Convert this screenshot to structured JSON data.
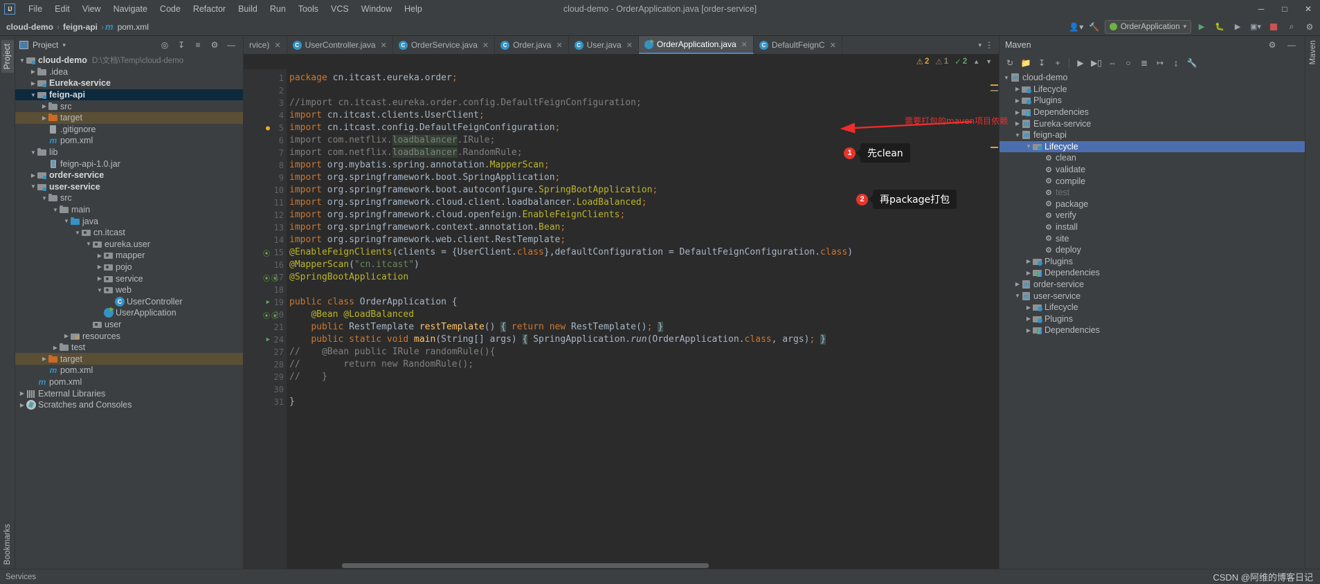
{
  "titlebar": {
    "logo": "IJ",
    "menus": [
      "File",
      "Edit",
      "View",
      "Navigate",
      "Code",
      "Refactor",
      "Build",
      "Run",
      "Tools",
      "VCS",
      "Window",
      "Help"
    ],
    "window_title": "cloud-demo - OrderApplication.java [order-service]",
    "minimize": "─",
    "maximize": "□",
    "close": "✕"
  },
  "navbar": {
    "crumb1": "cloud-demo",
    "crumb2": "feign-api",
    "crumb3": "pom.xml",
    "sep": "›",
    "m_icon": "m",
    "run_config": "OrderApplication",
    "search_icon": "⌕",
    "settings_icon": "⚙"
  },
  "project_panel": {
    "title": "Project",
    "vertical_label": "Project",
    "items": [
      {
        "depth": 0,
        "arrow": "v",
        "icon": "module",
        "label": "cloud-demo",
        "bold": true,
        "path": "D:\\文档\\Temp\\cloud-demo",
        "state": "none"
      },
      {
        "depth": 1,
        "arrow": ">",
        "icon": "folder",
        "label": ".idea",
        "bold": false,
        "path": "",
        "state": "none"
      },
      {
        "depth": 1,
        "arrow": ">",
        "icon": "module",
        "label": "Eureka-service",
        "bold": true,
        "path": "",
        "state": "none"
      },
      {
        "depth": 1,
        "arrow": "v",
        "icon": "module",
        "label": "feign-api",
        "bold": true,
        "path": "",
        "state": "blue"
      },
      {
        "depth": 2,
        "arrow": ">",
        "icon": "folder",
        "label": "src",
        "bold": false,
        "path": "",
        "state": "none"
      },
      {
        "depth": 2,
        "arrow": ">",
        "icon": "folder-orange",
        "label": "target",
        "bold": false,
        "path": "",
        "state": "tan"
      },
      {
        "depth": 2,
        "arrow": "",
        "icon": "git",
        "label": ".gitignore",
        "bold": false,
        "path": "",
        "state": "none"
      },
      {
        "depth": 2,
        "arrow": "",
        "icon": "mvn",
        "label": "pom.xml",
        "bold": false,
        "path": "",
        "state": "none"
      },
      {
        "depth": 1,
        "arrow": "v",
        "icon": "folder",
        "label": "lib",
        "bold": false,
        "path": "",
        "state": "none"
      },
      {
        "depth": 2,
        "arrow": "",
        "icon": "jar",
        "label": "feign-api-1.0.jar",
        "bold": false,
        "path": "",
        "state": "none"
      },
      {
        "depth": 1,
        "arrow": ">",
        "icon": "module",
        "label": "order-service",
        "bold": true,
        "path": "",
        "state": "none"
      },
      {
        "depth": 1,
        "arrow": "v",
        "icon": "module",
        "label": "user-service",
        "bold": true,
        "path": "",
        "state": "none"
      },
      {
        "depth": 2,
        "arrow": "v",
        "icon": "folder",
        "label": "src",
        "bold": false,
        "path": "",
        "state": "none"
      },
      {
        "depth": 3,
        "arrow": "v",
        "icon": "folder",
        "label": "main",
        "bold": false,
        "path": "",
        "state": "none"
      },
      {
        "depth": 4,
        "arrow": "v",
        "icon": "folder-blue",
        "label": "java",
        "bold": false,
        "path": "",
        "state": "none"
      },
      {
        "depth": 5,
        "arrow": "v",
        "icon": "pkg",
        "label": "cn.itcast",
        "bold": false,
        "path": "",
        "state": "none"
      },
      {
        "depth": 6,
        "arrow": "v",
        "icon": "pkg",
        "label": "eureka.user",
        "bold": false,
        "path": "",
        "state": "none"
      },
      {
        "depth": 7,
        "arrow": ">",
        "icon": "pkg",
        "label": "mapper",
        "bold": false,
        "path": "",
        "state": "none"
      },
      {
        "depth": 7,
        "arrow": ">",
        "icon": "pkg",
        "label": "pojo",
        "bold": false,
        "path": "",
        "state": "none"
      },
      {
        "depth": 7,
        "arrow": ">",
        "icon": "pkg",
        "label": "service",
        "bold": false,
        "path": "",
        "state": "none"
      },
      {
        "depth": 7,
        "arrow": "v",
        "icon": "pkg",
        "label": "web",
        "bold": false,
        "path": "",
        "state": "none"
      },
      {
        "depth": 8,
        "arrow": "",
        "icon": "cls",
        "label": "UserController",
        "bold": false,
        "path": "",
        "state": "none"
      },
      {
        "depth": 7,
        "arrow": "",
        "icon": "spring",
        "label": "UserApplication",
        "bold": false,
        "path": "",
        "state": "none"
      },
      {
        "depth": 6,
        "arrow": "",
        "icon": "pkg",
        "label": "user",
        "bold": false,
        "path": "",
        "state": "none"
      },
      {
        "depth": 4,
        "arrow": ">",
        "icon": "res",
        "label": "resources",
        "bold": false,
        "path": "",
        "state": "none"
      },
      {
        "depth": 3,
        "arrow": ">",
        "icon": "folder",
        "label": "test",
        "bold": false,
        "path": "",
        "state": "none"
      },
      {
        "depth": 2,
        "arrow": ">",
        "icon": "folder-orange",
        "label": "target",
        "bold": false,
        "path": "",
        "state": "tan"
      },
      {
        "depth": 2,
        "arrow": "",
        "icon": "mvn",
        "label": "pom.xml",
        "bold": false,
        "path": "",
        "state": "none"
      },
      {
        "depth": 1,
        "arrow": "",
        "icon": "mvn",
        "label": "pom.xml",
        "bold": false,
        "path": "",
        "state": "none"
      },
      {
        "depth": 0,
        "arrow": ">",
        "icon": "lib",
        "label": "External Libraries",
        "bold": false,
        "path": "",
        "state": "none"
      },
      {
        "depth": 0,
        "arrow": ">",
        "icon": "scratch",
        "label": "Scratches and Consoles",
        "bold": false,
        "path": "",
        "state": "none"
      }
    ]
  },
  "editor": {
    "tabs": [
      {
        "label": "rvice)",
        "icon": "none",
        "active": false
      },
      {
        "label": "UserController.java",
        "icon": "class",
        "active": false
      },
      {
        "label": "OrderService.java",
        "icon": "class",
        "active": false
      },
      {
        "label": "Order.java",
        "icon": "class",
        "active": false
      },
      {
        "label": "User.java",
        "icon": "class",
        "active": false
      },
      {
        "label": "OrderApplication.java",
        "icon": "spring",
        "active": true
      },
      {
        "label": "DefaultFeignC",
        "icon": "class",
        "active": false
      }
    ],
    "inspections": {
      "warnings": "2",
      "weak_warnings": "1",
      "ok": "2"
    },
    "lines": [
      {
        "n": "1",
        "marks": [
          "",
          ""
        ],
        "fold": ""
      },
      {
        "n": "2",
        "marks": [
          "",
          ""
        ],
        "fold": ""
      },
      {
        "n": "3",
        "marks": [
          "",
          ""
        ],
        "fold": ""
      },
      {
        "n": "4",
        "marks": [
          "",
          ""
        ],
        "fold": "minus"
      },
      {
        "n": "5",
        "marks": [
          "bulb",
          ""
        ],
        "fold": ""
      },
      {
        "n": "6",
        "marks": [
          "",
          ""
        ],
        "fold": ""
      },
      {
        "n": "7",
        "marks": [
          "",
          ""
        ],
        "fold": ""
      },
      {
        "n": "8",
        "marks": [
          "",
          ""
        ],
        "fold": ""
      },
      {
        "n": "9",
        "marks": [
          "",
          ""
        ],
        "fold": ""
      },
      {
        "n": "10",
        "marks": [
          "",
          ""
        ],
        "fold": ""
      },
      {
        "n": "11",
        "marks": [
          "",
          ""
        ],
        "fold": ""
      },
      {
        "n": "12",
        "marks": [
          "",
          ""
        ],
        "fold": ""
      },
      {
        "n": "13",
        "marks": [
          "",
          ""
        ],
        "fold": ""
      },
      {
        "n": "14",
        "marks": [
          "",
          ""
        ],
        "fold": "minus"
      },
      {
        "n": "15",
        "marks": [
          "leaf",
          ""
        ],
        "fold": "minus"
      },
      {
        "n": "16",
        "marks": [
          "",
          ""
        ],
        "fold": ""
      },
      {
        "n": "17",
        "marks": [
          "leaf",
          "leaf"
        ],
        "fold": "minus"
      },
      {
        "n": "18",
        "marks": [
          "",
          ""
        ],
        "fold": ""
      },
      {
        "n": "19",
        "marks": [
          "run",
          ""
        ],
        "fold": ""
      },
      {
        "n": "20",
        "marks": [
          "leaf",
          "leaf"
        ],
        "fold": ""
      },
      {
        "n": "21",
        "marks": [
          "",
          ""
        ],
        "fold": "plus"
      },
      {
        "n": "24",
        "marks": [
          "run",
          ""
        ],
        "fold": "plus"
      },
      {
        "n": "27",
        "marks": [
          "",
          ""
        ],
        "fold": "minus"
      },
      {
        "n": "28",
        "marks": [
          "",
          ""
        ],
        "fold": ""
      },
      {
        "n": "29",
        "marks": [
          "",
          ""
        ],
        "fold": "minus"
      },
      {
        "n": "30",
        "marks": [
          "",
          ""
        ],
        "fold": ""
      },
      {
        "n": "31",
        "marks": [
          "",
          ""
        ],
        "fold": ""
      }
    ],
    "code_text": {
      "l1": "package cn.itcast.eureka.order;",
      "l3": "//import cn.itcast.eureka.order.config.DefaultFeignConfiguration;",
      "l4": "import cn.itcast.clients.UserClient;",
      "l5": "import cn.itcast.config.DefaultFeignConfiguration;",
      "l6": "import com.netflix.loadbalancer.IRule;",
      "l7": "import com.netflix.loadbalancer.RandomRule;",
      "l8": "import org.mybatis.spring.annotation.MapperScan;",
      "l9": "import org.springframework.boot.SpringApplication;",
      "l10": "import org.springframework.boot.autoconfigure.SpringBootApplication;",
      "l11": "import org.springframework.cloud.client.loadbalancer.LoadBalanced;",
      "l12": "import org.springframework.cloud.openfeign.EnableFeignClients;",
      "l13": "import org.springframework.context.annotation.Bean;",
      "l14": "import org.springframework.web.client.RestTemplate;",
      "l15": "@EnableFeignClients(clients = {UserClient.class},defaultConfiguration = DefaultFeignConfiguration.class)",
      "l16": "@MapperScan(\"cn.itcast\")",
      "l17": "@SpringBootApplication",
      "l19": "public class OrderApplication {",
      "l20": "@Bean @LoadBalanced",
      "l21": "public RestTemplate restTemplate() { return new RestTemplate(); }",
      "l24": "public static void main(String[] args) { SpringApplication.run(OrderApplication.class, args); }",
      "l27": "//    @Bean public IRule randomRule(){",
      "l28": "//        return new RandomRule();",
      "l29": "//    }",
      "l31": "}"
    }
  },
  "maven_panel": {
    "title": "Maven",
    "vertical_label": "Maven",
    "toolbar_icons": [
      "refresh-icon",
      "add-folder-icon",
      "download-icon",
      "plus-icon",
      "run-icon",
      "execute-icon",
      "toggle-icon",
      "skip-tests-icon",
      "settings-icon",
      "collapse-icon",
      "expand-icon",
      "wrench-icon"
    ],
    "items": [
      {
        "depth": 0,
        "arrow": "v",
        "icon": "mvnmod",
        "label": "cloud-demo",
        "state": "none"
      },
      {
        "depth": 1,
        "arrow": ">",
        "icon": "phfolder",
        "label": "Lifecycle",
        "state": "none"
      },
      {
        "depth": 1,
        "arrow": ">",
        "icon": "phfolder",
        "label": "Plugins",
        "state": "none"
      },
      {
        "depth": 1,
        "arrow": ">",
        "icon": "depfolder",
        "label": "Dependencies",
        "state": "none"
      },
      {
        "depth": 1,
        "arrow": ">",
        "icon": "mvnmod",
        "label": "Eureka-service",
        "state": "none"
      },
      {
        "depth": 1,
        "arrow": "v",
        "icon": "mvnmod",
        "label": "feign-api",
        "state": "none"
      },
      {
        "depth": 2,
        "arrow": "v",
        "icon": "phfolder",
        "label": "Lifecycle",
        "state": "sel"
      },
      {
        "depth": 3,
        "arrow": "",
        "icon": "gear",
        "label": "clean",
        "state": "none"
      },
      {
        "depth": 3,
        "arrow": "",
        "icon": "gear",
        "label": "validate",
        "state": "none"
      },
      {
        "depth": 3,
        "arrow": "",
        "icon": "gear",
        "label": "compile",
        "state": "none"
      },
      {
        "depth": 3,
        "arrow": "",
        "icon": "gear",
        "label": "test",
        "state": "dim"
      },
      {
        "depth": 3,
        "arrow": "",
        "icon": "gear",
        "label": "package",
        "state": "none"
      },
      {
        "depth": 3,
        "arrow": "",
        "icon": "gear",
        "label": "verify",
        "state": "none"
      },
      {
        "depth": 3,
        "arrow": "",
        "icon": "gear",
        "label": "install",
        "state": "none"
      },
      {
        "depth": 3,
        "arrow": "",
        "icon": "gear",
        "label": "site",
        "state": "none"
      },
      {
        "depth": 3,
        "arrow": "",
        "icon": "gear",
        "label": "deploy",
        "state": "none"
      },
      {
        "depth": 2,
        "arrow": ">",
        "icon": "phfolder",
        "label": "Plugins",
        "state": "none"
      },
      {
        "depth": 2,
        "arrow": ">",
        "icon": "depfolder",
        "label": "Dependencies",
        "state": "none"
      },
      {
        "depth": 1,
        "arrow": ">",
        "icon": "mvnmod",
        "label": "order-service",
        "state": "none"
      },
      {
        "depth": 1,
        "arrow": "v",
        "icon": "mvnmod",
        "label": "user-service",
        "state": "none"
      },
      {
        "depth": 2,
        "arrow": ">",
        "icon": "phfolder",
        "label": "Lifecycle",
        "state": "none"
      },
      {
        "depth": 2,
        "arrow": ">",
        "icon": "phfolder",
        "label": "Plugins",
        "state": "none"
      },
      {
        "depth": 2,
        "arrow": ">",
        "icon": "depfolder",
        "label": "Dependencies",
        "state": "none"
      }
    ]
  },
  "annotations": {
    "arrow_label": "需要打包的maven项目依赖",
    "callout1_badge": "1",
    "callout1_text": "先clean",
    "callout2_badge": "2",
    "callout2_text": "再package打包"
  },
  "statusbar": {
    "services": "Services",
    "watermark": "CSDN @阿维的博客日记",
    "bookmarks_label": "Bookmarks"
  },
  "colors": {
    "accent_blue": "#4b6eaf",
    "selection_blue": "#0d293e",
    "selection_tan": "#5a4f35",
    "annotation_red": "#e8342a",
    "spring_green": "#6db33f"
  }
}
